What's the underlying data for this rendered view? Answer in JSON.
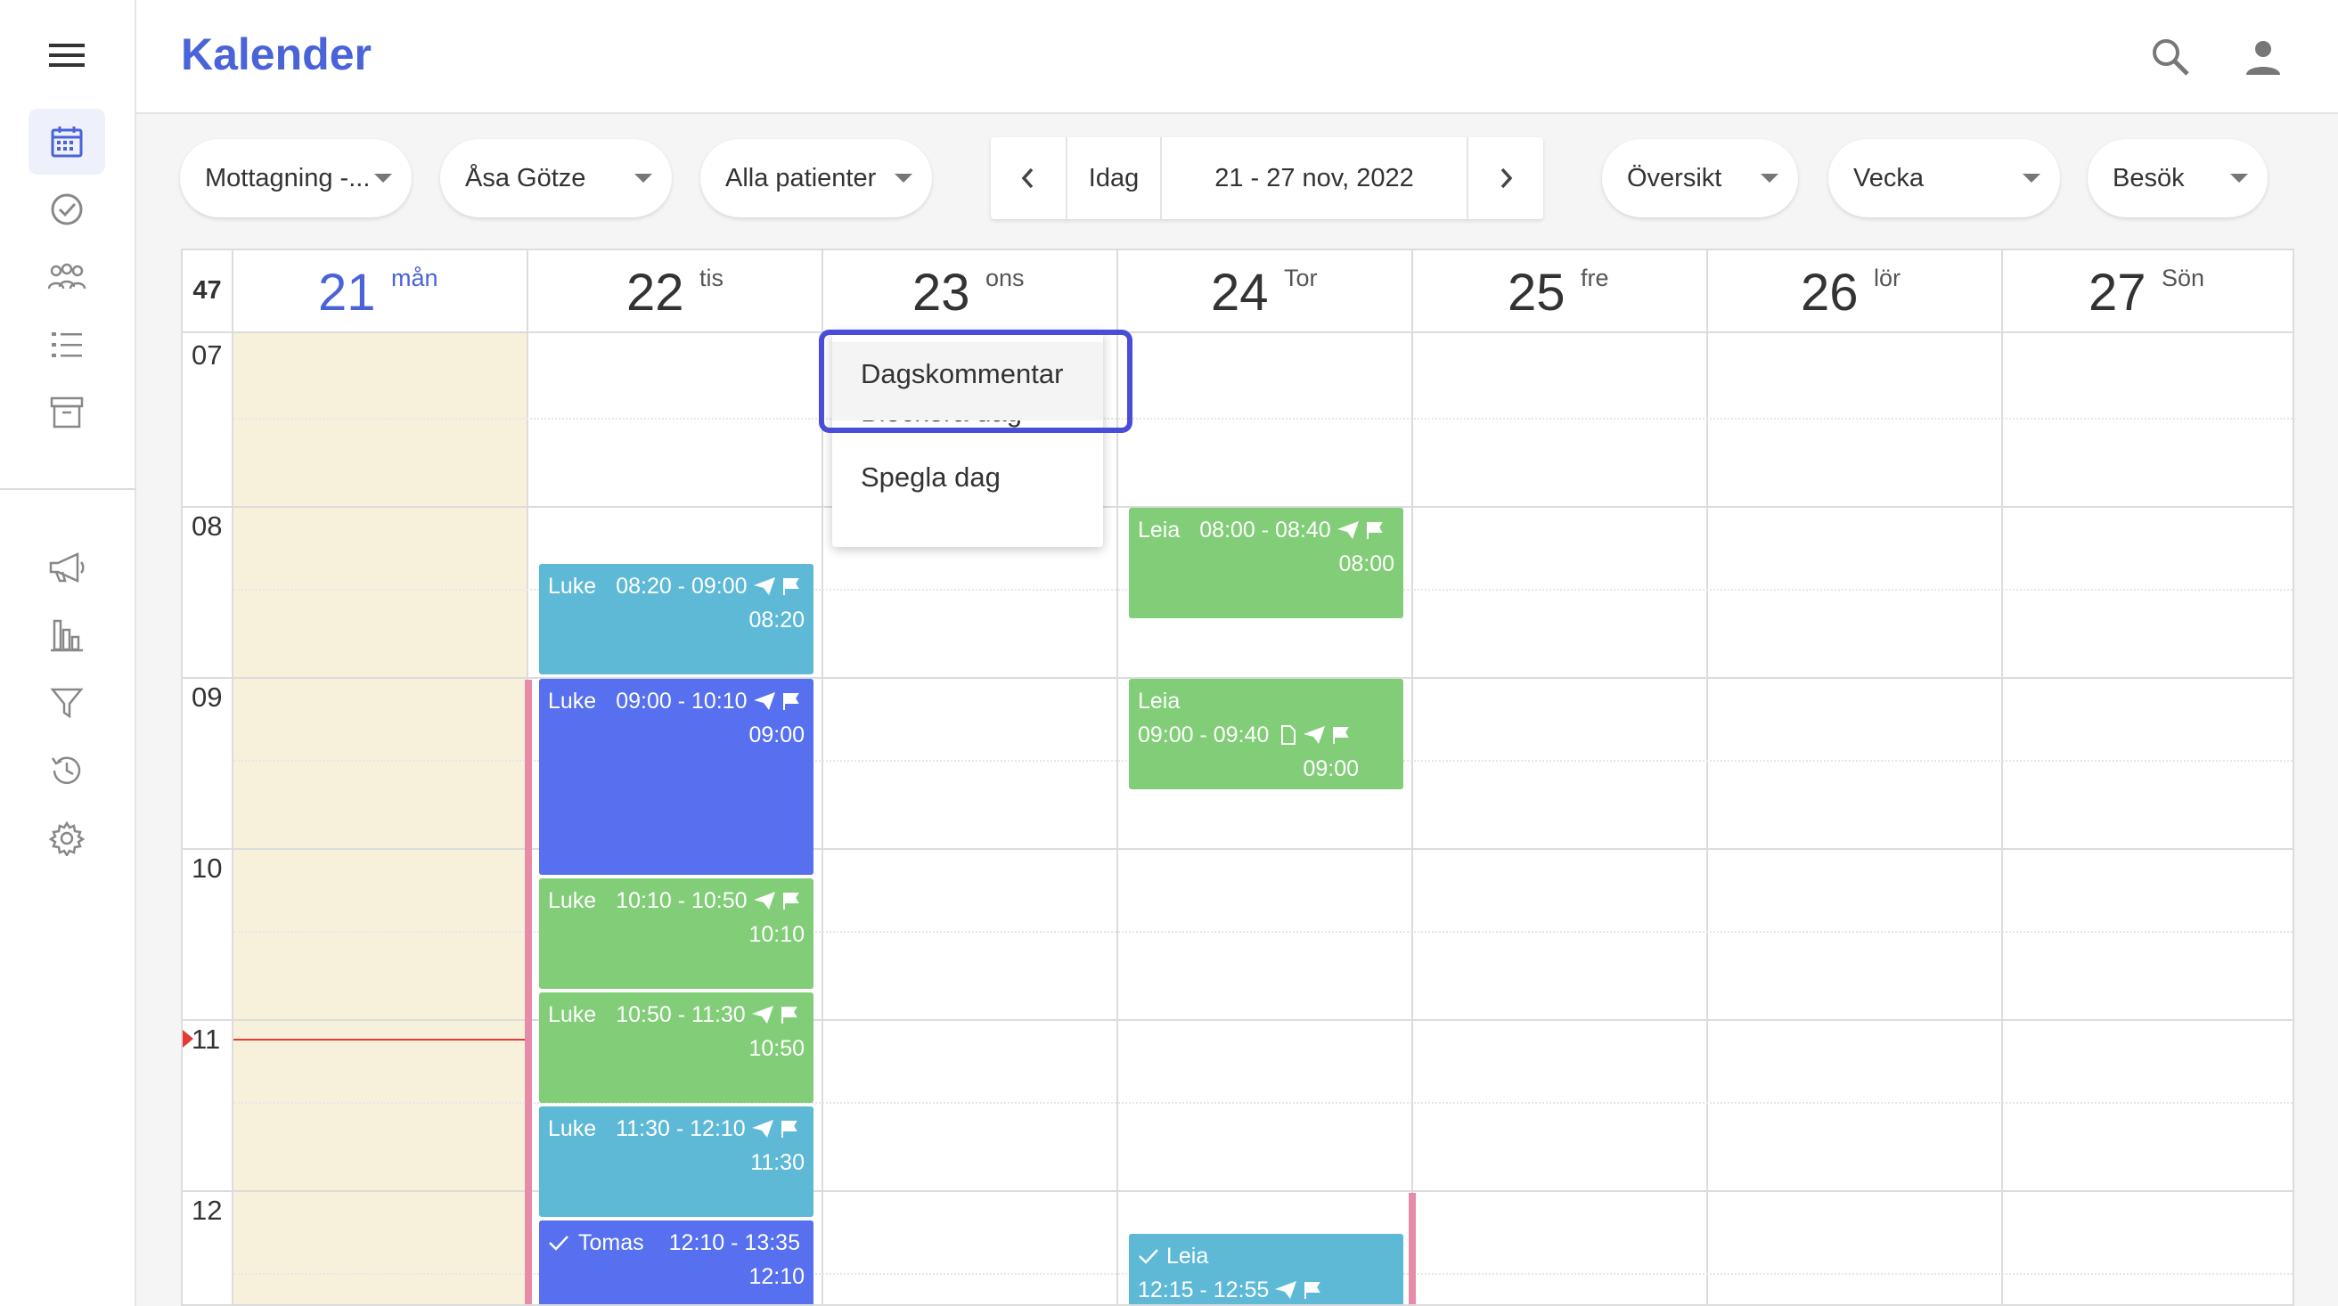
{
  "app": {
    "title": "Kalender"
  },
  "sidebar": {
    "top_items": [
      "calendar-icon",
      "check-circle-icon",
      "group-icon",
      "list-icon",
      "archive-icon"
    ],
    "bottom_items": [
      "megaphone-icon",
      "bar-chart-icon",
      "filter-icon",
      "history-icon",
      "settings-icon"
    ]
  },
  "toolbar": {
    "clinic": "Mottagning -...",
    "practitioner": "Åsa Götze",
    "patients": "Alla patienter",
    "today": "Idag",
    "range": "21 - 27 nov, 2022",
    "view_mode": "Översikt",
    "period": "Vecka",
    "type": "Besök"
  },
  "calendar": {
    "week": "47",
    "days": [
      {
        "num": "21",
        "name": "mån",
        "today": true
      },
      {
        "num": "22",
        "name": "tis"
      },
      {
        "num": "23",
        "name": "ons"
      },
      {
        "num": "24",
        "name": "Tor"
      },
      {
        "num": "25",
        "name": "fre"
      },
      {
        "num": "26",
        "name": "lör"
      },
      {
        "num": "27",
        "name": "Sön"
      }
    ],
    "hours": [
      "07",
      "08",
      "09",
      "10",
      "11",
      "12"
    ],
    "events": {
      "e1": {
        "name": "Luke",
        "time": "08:20 - 09:00",
        "start": "08:20"
      },
      "e2": {
        "name": "Luke",
        "time": "09:00 - 10:10",
        "start": "09:00"
      },
      "e3": {
        "name": "Luke",
        "time": "10:10 - 10:50",
        "start": "10:10"
      },
      "e4": {
        "name": "Luke",
        "time": "10:50 - 11:30",
        "start": "10:50"
      },
      "e5": {
        "name": "Luke",
        "time": "11:30 - 12:10",
        "start": "11:30"
      },
      "e6": {
        "name": "Tomas",
        "time": "12:10 - 13:35",
        "start": "12:10"
      },
      "e7": {
        "name": "Leia",
        "time": "08:00 - 08:40",
        "start": "08:00"
      },
      "e8": {
        "name": "Leia",
        "time": "09:00 - 09:40",
        "start": "09:00"
      },
      "e9": {
        "name": "Leia",
        "time": "12:15 - 12:55"
      }
    }
  },
  "context_menu": {
    "items": [
      "Dagskommentar",
      "Blockera dag",
      "Spegla dag"
    ]
  },
  "colors": {
    "accent": "#4a63d8",
    "blue_event": "#5eb9d6",
    "indigo_event": "#5670ef",
    "green_event": "#82ce78",
    "today_bg": "#f7f1dc"
  }
}
